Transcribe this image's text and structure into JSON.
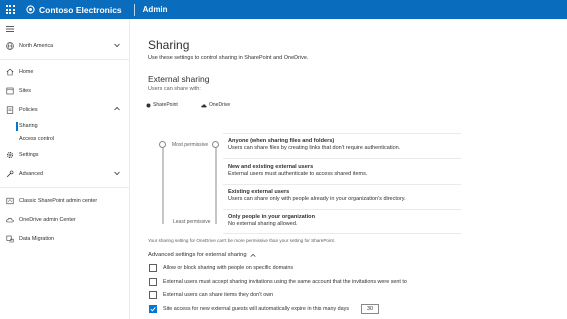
{
  "topbar": {
    "brand": "Contoso Electronics",
    "section": "Admin"
  },
  "sidebar": {
    "region": "North America",
    "items": {
      "home": "Home",
      "sites": "Sites",
      "policies": "Policies",
      "sharing": "Sharing",
      "access_control": "Access control",
      "settings": "Settings",
      "advanced": "Advanced",
      "classic": "Classic SharePoint admin center",
      "onedrive": "OneDrive admin Center",
      "migration": "Data Migration"
    }
  },
  "main": {
    "title": "Sharing",
    "intro": "Use these settings to control sharing in SharePoint and OneDrive.",
    "external_title": "External sharing",
    "users_can_share": "Users can share with:",
    "col_sharepoint": "SharePoint",
    "col_onedrive": "OneDrive",
    "most_permissive": "Most permissive",
    "least_permissive": "Least permissive",
    "options": [
      {
        "title": "Anyone (when sharing files and folders)",
        "desc": "Users can share files by creating links that don't require authentication."
      },
      {
        "title": "New and existing external users",
        "desc": "External users must authenticate to access shared items."
      },
      {
        "title": "Existing external users",
        "desc": "Users can share only with people already in your organization's directory."
      },
      {
        "title": "Only people in your organization",
        "desc": "No external sharing allowed."
      }
    ],
    "note": "Your sharing setting for OneDrive can't be more permissive than your setting for SharePoint.",
    "advanced_title": "Advanced settings for external sharing",
    "advanced": [
      {
        "label": "Allow or block sharing with people on specific domains",
        "checked": false
      },
      {
        "label": "External users must accept sharing invitations using the same account that the invitations were sent to",
        "checked": false
      },
      {
        "label": "External users can share items they don't own",
        "checked": false
      },
      {
        "label": "Site access for new external guests will automatically expire in this many days",
        "checked": true
      }
    ],
    "expire_days": "30"
  }
}
